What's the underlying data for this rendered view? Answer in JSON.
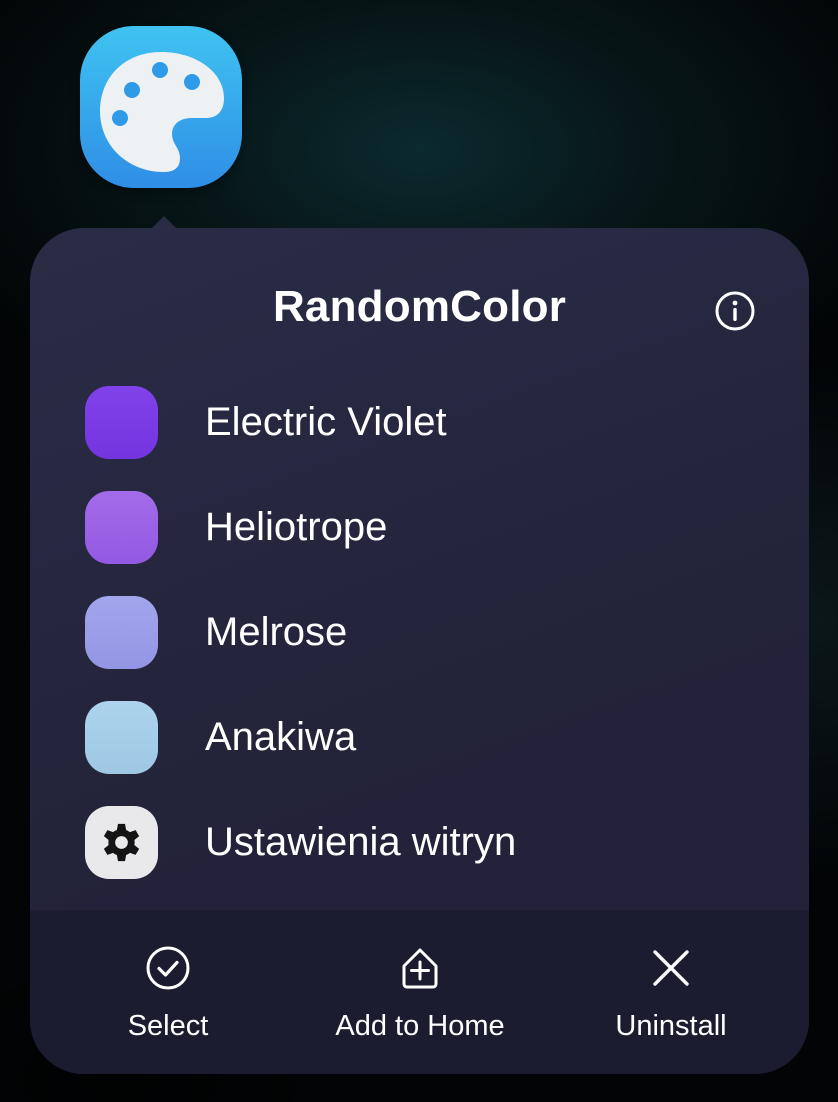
{
  "app": {
    "name": "RandomColor",
    "icon": "palette-icon",
    "icon_colors": [
      "#3fc3f1",
      "#2f8ee6"
    ]
  },
  "popup": {
    "title": "RandomColor",
    "info_icon": "info-icon",
    "shortcuts": [
      {
        "label": "Electric Violet",
        "color": "#7b3be6",
        "icon": "color-swatch"
      },
      {
        "label": "Heliotrope",
        "color": "#9a62e6",
        "icon": "color-swatch"
      },
      {
        "label": "Melrose",
        "color": "#9c9ee9",
        "icon": "color-swatch"
      },
      {
        "label": "Anakiwa",
        "color": "#a4cde8",
        "icon": "color-swatch"
      },
      {
        "label": "Ustawienia witryn",
        "color": "#e9e9ec",
        "icon": "gear-icon"
      }
    ],
    "actions": [
      {
        "label": "Select",
        "icon": "check-circle-icon"
      },
      {
        "label": "Add to Home",
        "icon": "add-to-home-icon"
      },
      {
        "label": "Uninstall",
        "icon": "close-icon"
      }
    ]
  }
}
